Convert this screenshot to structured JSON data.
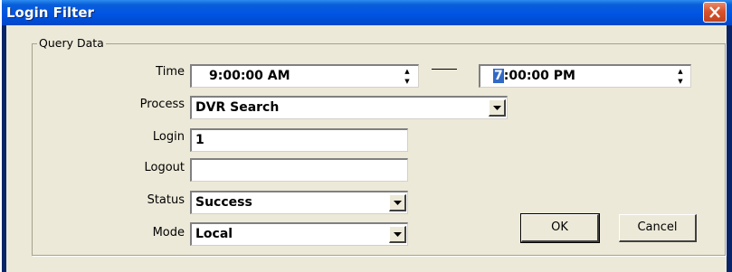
{
  "window": {
    "title": "Login Filter"
  },
  "group": {
    "title": "Query Data"
  },
  "fields": {
    "time": {
      "label": "Time",
      "start": "9:00:00 AM",
      "end_highlight": "7",
      "end_rest": ":00:00 PM"
    },
    "process": {
      "label": "Process",
      "value": "DVR Search"
    },
    "login": {
      "label": "Login",
      "value": "1"
    },
    "logout": {
      "label": "Logout",
      "value": ""
    },
    "status": {
      "label": "Status",
      "value": "Success"
    },
    "mode": {
      "label": "Mode",
      "value": "Local"
    }
  },
  "buttons": {
    "ok": "OK",
    "cancel": "Cancel"
  },
  "icons": {
    "close": "close-icon",
    "spinner": "spin-arrows-icon",
    "dropdown": "chevron-down-icon"
  }
}
